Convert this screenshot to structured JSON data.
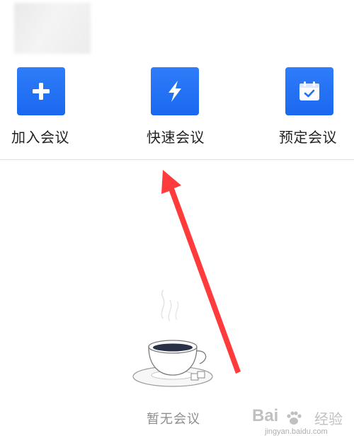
{
  "actions": [
    {
      "label": "加入会议",
      "icon": "plus-icon"
    },
    {
      "label": "快速会议",
      "icon": "lightning-icon"
    },
    {
      "label": "预定会议",
      "icon": "calendar-check-icon"
    }
  ],
  "empty_state": {
    "text": "暂无会议",
    "illustration": "coffee-cup-icon"
  },
  "annotation": {
    "icon": "red-arrow-icon",
    "color": "#ff3b3b"
  },
  "watermark": {
    "brand": "Bai",
    "brand_suffix": "经验",
    "url": "jingyan.baidu.com",
    "icon": "paw-icon"
  },
  "colors": {
    "accent": "#1f6ff5",
    "label_text": "#222222",
    "muted_text": "#8e8e8e"
  }
}
